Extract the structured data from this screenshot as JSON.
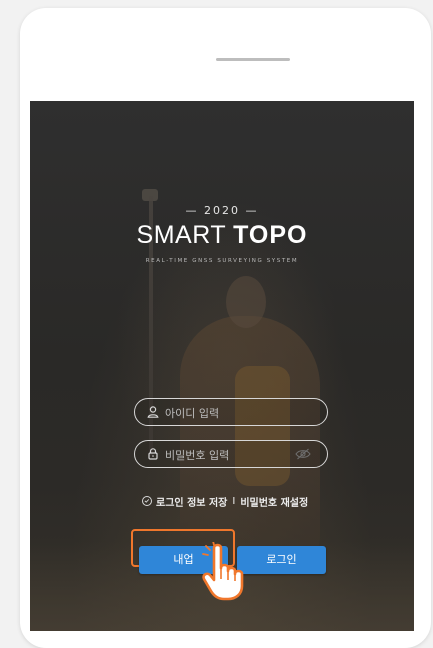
{
  "splash": {
    "year": "— 2020 —",
    "logo_light": "SMART",
    "logo_bold": "TOPO",
    "tagline": "REAL-TIME GNSS SURVEYING SYSTEM"
  },
  "login_form": {
    "id_placeholder": "아이디 입력",
    "password_placeholder": "비밀번호 입력",
    "save_login_label": "로그인 정보 저장",
    "separator": "I",
    "reset_password_label": "비밀번호 재설정"
  },
  "buttons": {
    "left_label": "내업",
    "login_label": "로그인"
  },
  "colors": {
    "button_blue": "#2f86d8",
    "highlight_orange": "#f0772c",
    "screen_dark": "#2f2f2f"
  },
  "icons": {
    "id_field": "user-icon",
    "password_field": "lock-icon",
    "password_toggle": "eye-icon",
    "save_checkbox": "check-circle-icon",
    "pointer": "hand-pointer-icon"
  }
}
